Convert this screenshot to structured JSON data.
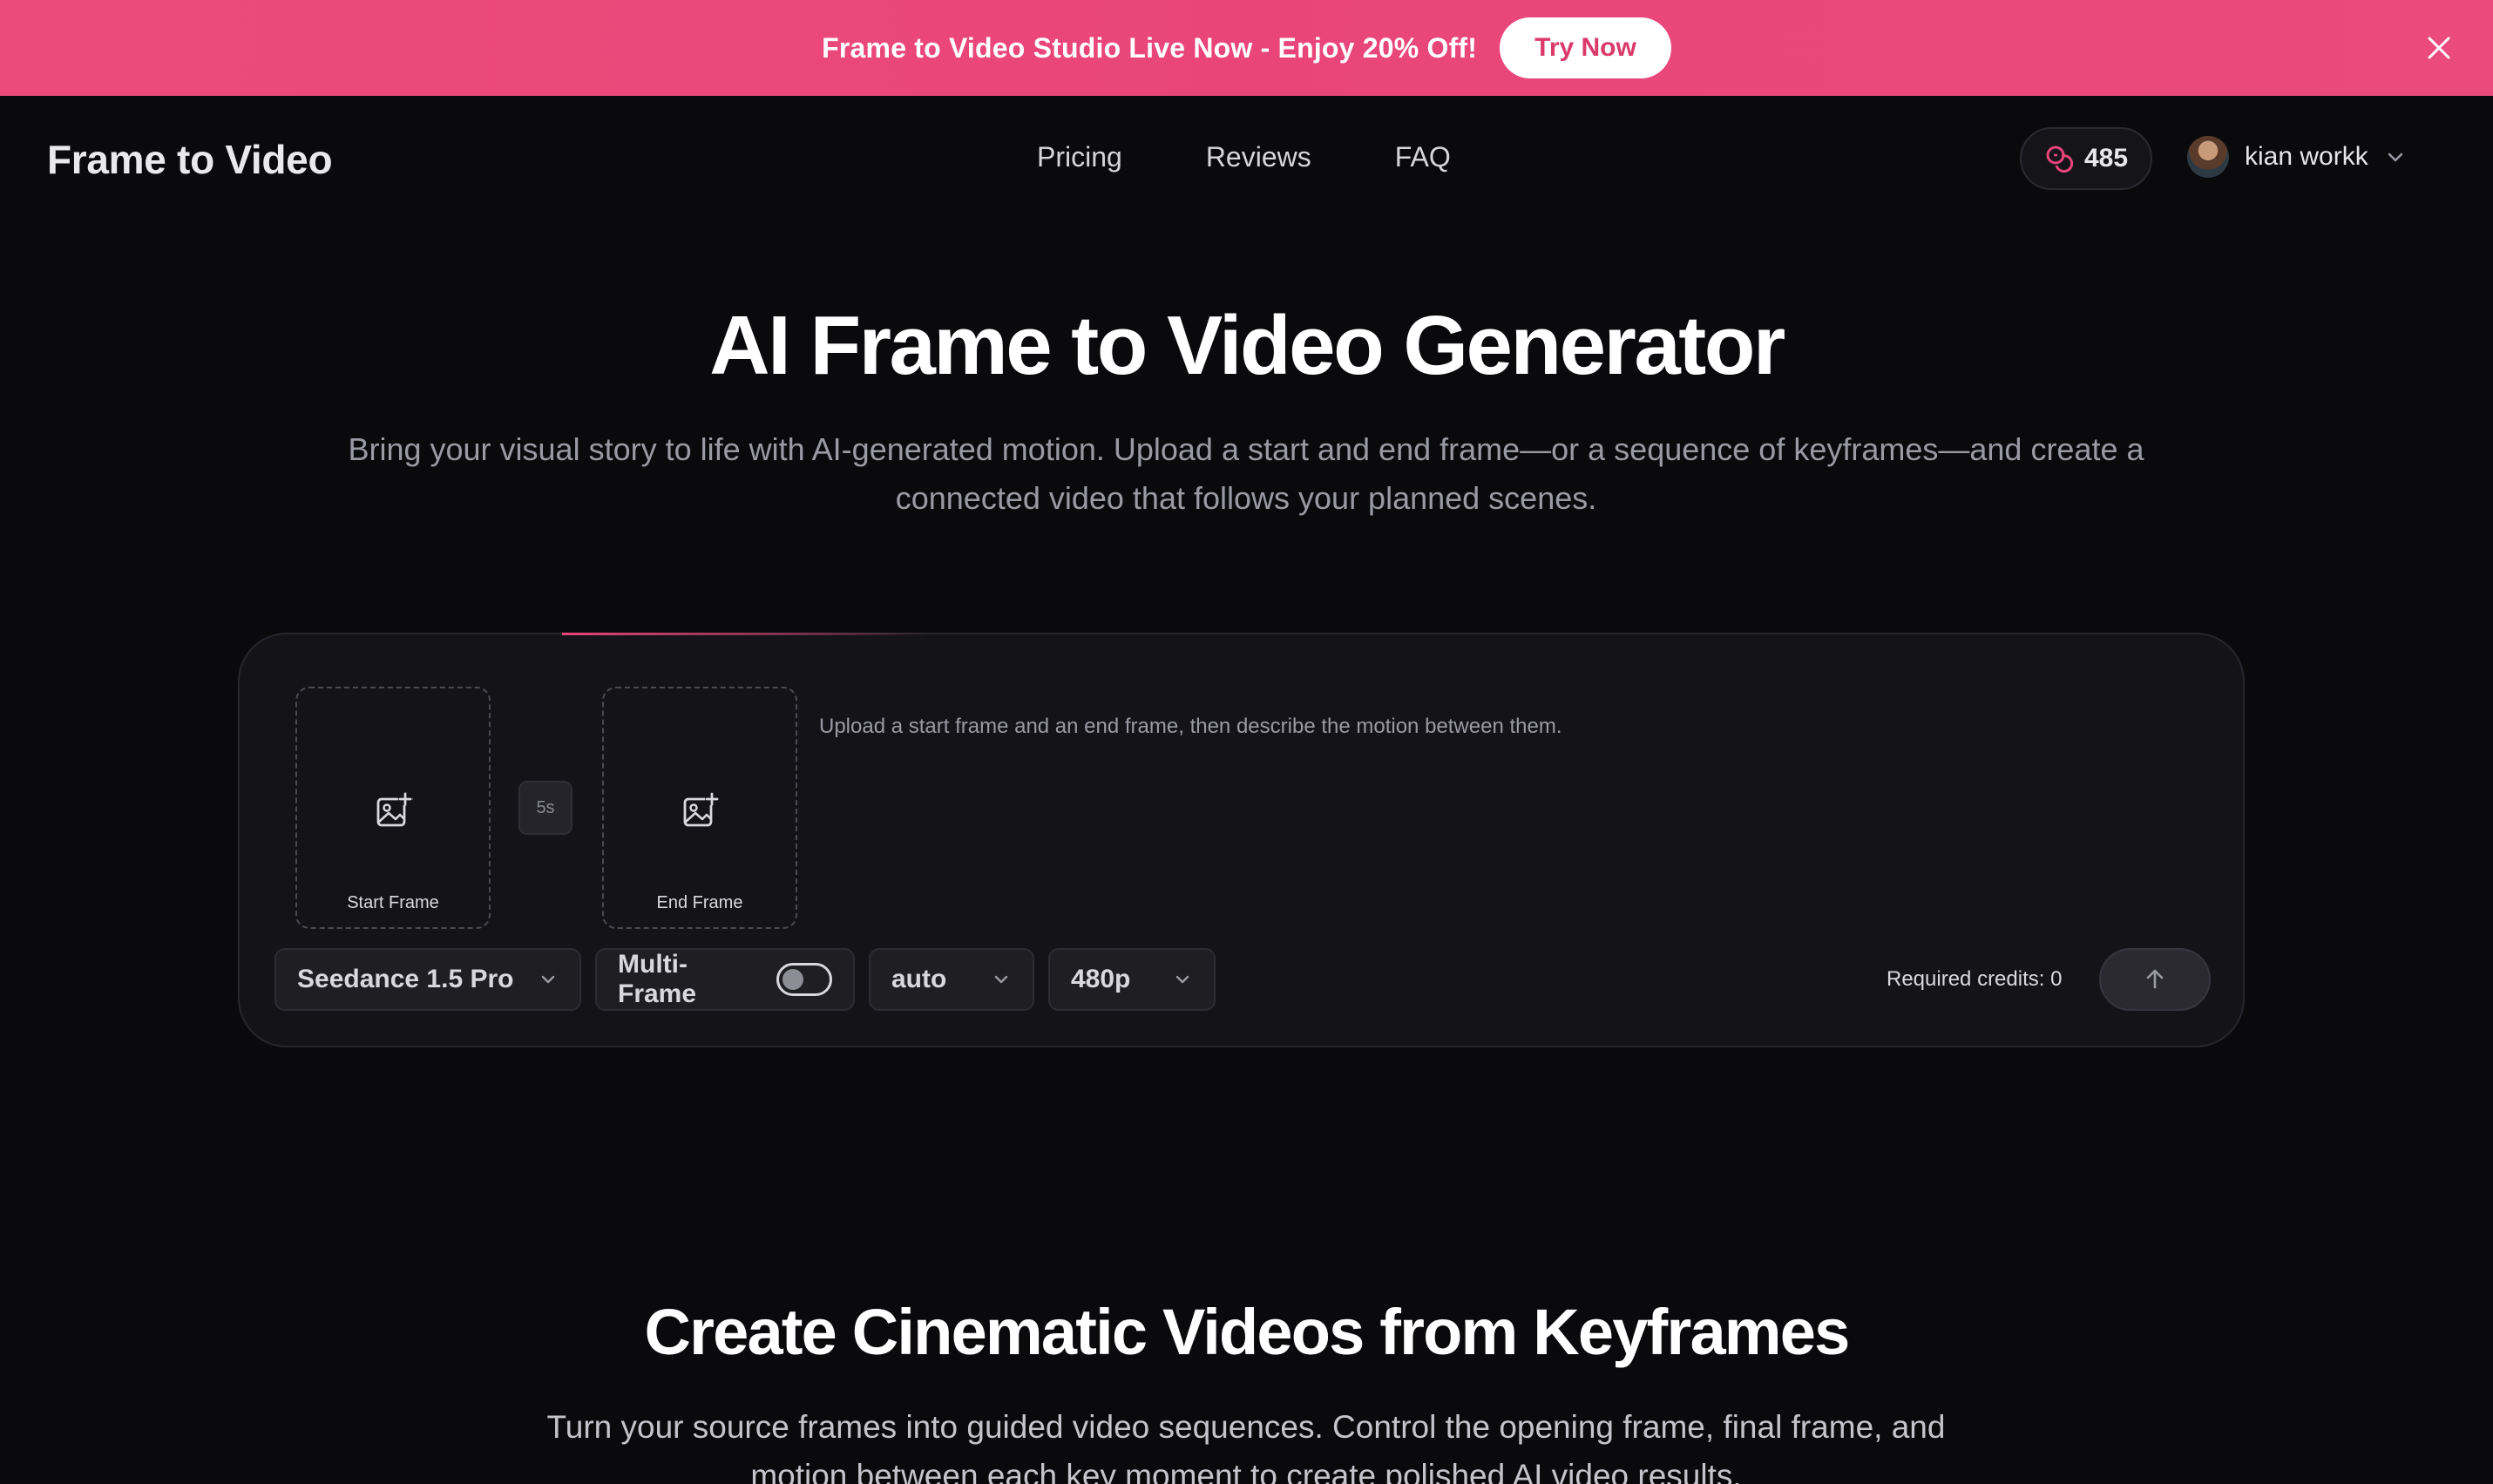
{
  "banner": {
    "text": "Frame to Video Studio Live Now - Enjoy 20% Off!",
    "cta": "Try Now",
    "close_icon": "close-icon"
  },
  "header": {
    "logo": "Frame to Video",
    "nav": [
      "Pricing",
      "Reviews",
      "FAQ"
    ],
    "credits": "485",
    "credits_icon": "coins-icon",
    "user_name": "kian workk",
    "user_menu_icon": "chevron-down-icon"
  },
  "hero": {
    "title": "AI Frame to Video Generator",
    "subtitle": "Bring your visual story to life with AI-generated motion. Upload a start and end frame—or a sequence of keyframes—and create a connected video that follows your planned scenes."
  },
  "generator": {
    "start_frame_label": "Start Frame",
    "end_frame_label": "End Frame",
    "duration": "5s",
    "hint": "Upload a start frame and an end frame, then describe the motion between them.",
    "model": "Seedance 1.5 Pro",
    "multi_frame_label": "Multi-Frame",
    "multi_frame_enabled": false,
    "aspect_ratio": "auto",
    "resolution": "480p",
    "required_credits": "Required credits: 0",
    "upload_icon": "image-plus-icon",
    "submit_icon": "arrow-up-icon"
  },
  "section": {
    "title": "Create Cinematic Videos from Keyframes",
    "subtitle": "Turn your source frames into guided video sequences. Control the opening frame, final frame, and motion between each key moment to create polished AI video results."
  },
  "colors": {
    "banner": "#ec4b79",
    "background": "#0a0a0d",
    "card": "#141418",
    "accent": "#e9457a"
  }
}
